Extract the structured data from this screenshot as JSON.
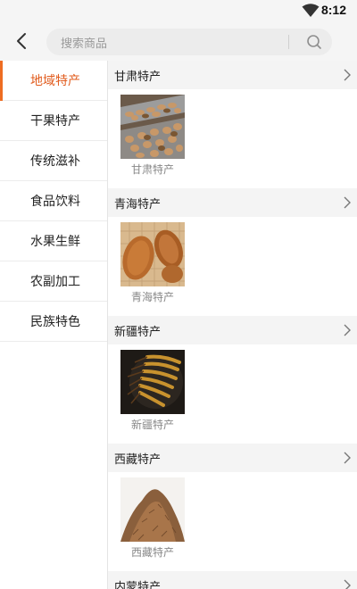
{
  "status": {
    "time": "8:12"
  },
  "header": {
    "search_placeholder": "搜索商品"
  },
  "sidebar": {
    "items": [
      {
        "label": "地域特产",
        "active": true
      },
      {
        "label": "干果特产"
      },
      {
        "label": "传统滋补"
      },
      {
        "label": "食品饮料"
      },
      {
        "label": "水果生鲜"
      },
      {
        "label": "农副加工"
      },
      {
        "label": "民族特色"
      }
    ]
  },
  "sections": [
    {
      "title": "甘肃特产",
      "products": [
        {
          "label": "甘肃特产",
          "icon": "nuts-photo"
        }
      ]
    },
    {
      "title": "青海特产",
      "products": [
        {
          "label": "青海特产",
          "icon": "almonds-photo"
        }
      ]
    },
    {
      "title": "新疆特产",
      "products": [
        {
          "label": "新疆特产",
          "icon": "cordyceps-photo"
        }
      ]
    },
    {
      "title": "西藏特产",
      "products": [
        {
          "label": "西藏特产",
          "icon": "saffron-photo"
        }
      ]
    },
    {
      "title": "内蒙特产"
    }
  ],
  "colors": {
    "accent": "#e15c1e",
    "sidebar_bg": "#ffffff",
    "section_bg": "#f4f4f4"
  }
}
